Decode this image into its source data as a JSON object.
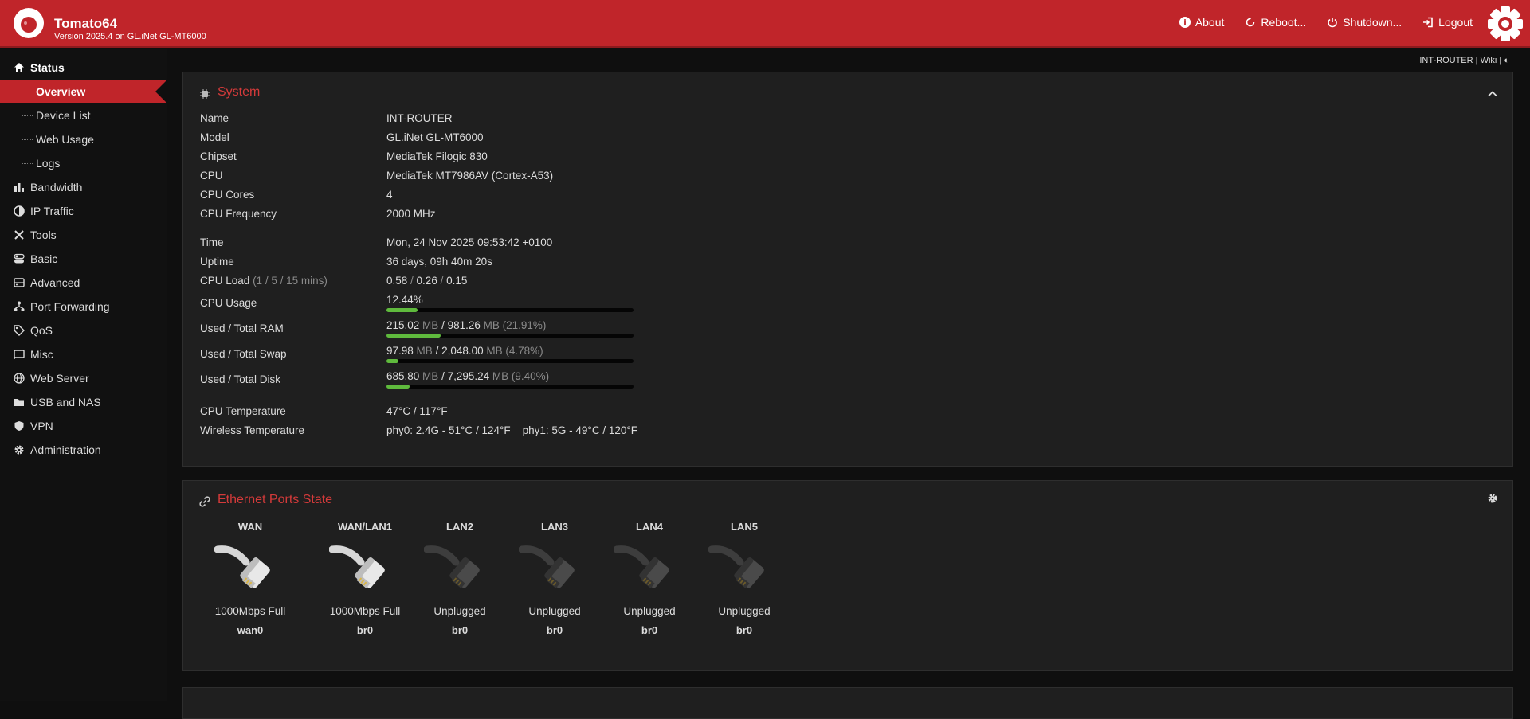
{
  "header": {
    "title": "Tomato64",
    "subtitle": "Version 2025.4 on GL.iNet GL-MT6000",
    "nav": [
      {
        "label": "About",
        "icon": "info-icon"
      },
      {
        "label": "Reboot...",
        "icon": "reboot-icon"
      },
      {
        "label": "Shutdown...",
        "icon": "power-icon"
      },
      {
        "label": "Logout",
        "icon": "logout-icon"
      }
    ]
  },
  "sidebar": {
    "status": "Status",
    "sub": [
      "Overview",
      "Device List",
      "Web Usage",
      "Logs"
    ],
    "items": [
      "Bandwidth",
      "IP Traffic",
      "Tools",
      "Basic",
      "Advanced",
      "Port Forwarding",
      "QoS",
      "Misc",
      "Web Server",
      "USB and NAS",
      "VPN",
      "Administration"
    ]
  },
  "topright": {
    "router": "INT-ROUTER",
    "sep1": " | ",
    "wiki": "Wiki",
    "sep2": " | ",
    "theme": "◐"
  },
  "system": {
    "title": "System",
    "rows": [
      {
        "label": "Name",
        "value": "INT-ROUTER"
      },
      {
        "label": "Model",
        "value": "GL.iNet GL-MT6000"
      },
      {
        "label": "Chipset",
        "value": "MediaTek Filogic 830"
      },
      {
        "label": "CPU",
        "value": "MediaTek MT7986AV (Cortex-A53)"
      },
      {
        "label": "CPU Cores",
        "value": "4"
      },
      {
        "label": "CPU Frequency",
        "value": "2000 MHz"
      },
      {
        "label": "Time",
        "value": "Mon, 24 Nov 2025 09:53:42 +0100"
      },
      {
        "label": "Uptime",
        "value": "36 days, 09h 40m 20s"
      }
    ],
    "cpu_load": {
      "label": "CPU Load",
      "label_hint": "(1 / 5 / 15 mins)",
      "v1": "0.58",
      "v2": "0.26",
      "v3": "0.15",
      "sep": " / "
    },
    "cpu_usage": {
      "label": "CPU Usage",
      "value": "12.44%",
      "fraction": 0.1244
    },
    "ram": {
      "label": "Used / Total RAM",
      "used": "215.02",
      "total": "981.26",
      "unit": " MB",
      "slash": " / ",
      "pct": " (21.91%)",
      "fraction": 0.2191
    },
    "swap": {
      "label": "Used / Total Swap",
      "used": "97.98",
      "total": "2,048.00",
      "unit": " MB",
      "slash": " / ",
      "pct": " (4.78%)",
      "fraction": 0.0478
    },
    "disk": {
      "label": "Used / Total Disk",
      "used": "685.80",
      "total": "7,295.24",
      "unit": " MB",
      "slash": " / ",
      "pct": " (9.40%)",
      "fraction": 0.094
    },
    "cpu_temp": {
      "label": "CPU Temperature",
      "value": "47°C / 117°F"
    },
    "wifi_temp": {
      "label": "Wireless Temperature",
      "value": "phy0: 2.4G - 51°C / 124°F    phy1: 5G - 49°C / 120°F"
    }
  },
  "ethernet": {
    "title": "Ethernet Ports State",
    "ports": [
      {
        "name": "WAN",
        "status": "1000Mbps Full",
        "iface": "wan0",
        "connected": true
      },
      {
        "name": "WAN/LAN1",
        "status": "1000Mbps Full",
        "iface": "br0",
        "connected": true
      },
      {
        "name": "LAN2",
        "status": "Unplugged",
        "iface": "br0",
        "connected": false
      },
      {
        "name": "LAN3",
        "status": "Unplugged",
        "iface": "br0",
        "connected": false
      },
      {
        "name": "LAN4",
        "status": "Unplugged",
        "iface": "br0",
        "connected": false
      },
      {
        "name": "LAN5",
        "status": "Unplugged",
        "iface": "br0",
        "connected": false
      }
    ]
  }
}
